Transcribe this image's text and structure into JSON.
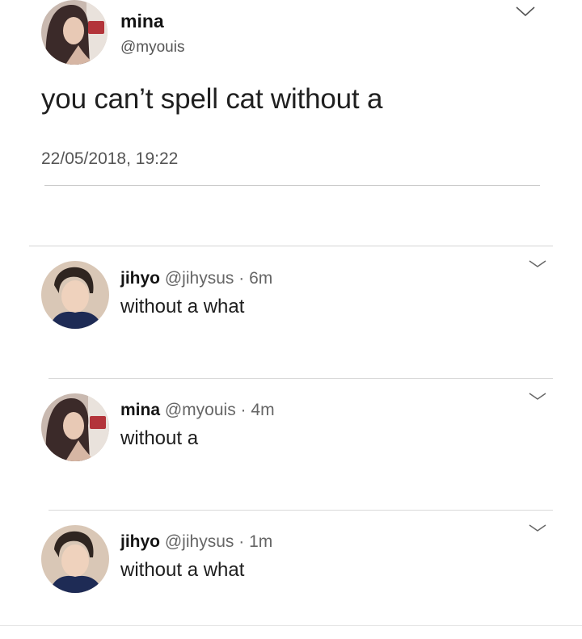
{
  "main_tweet": {
    "name": "mina",
    "handle": "@myouis",
    "text": "you can’t spell cat without a",
    "timestamp": "22/05/2018, 19:22",
    "menu_icon": "chevron-down-icon"
  },
  "replies": [
    {
      "name": "jihyo",
      "handle": "@jihysus",
      "separator": "·",
      "time": "6m",
      "text": "without a what",
      "menu_icon": "chevron-down-icon"
    },
    {
      "name": "mina",
      "handle": "@myouis",
      "separator": "·",
      "time": "4m",
      "text": "without a",
      "menu_icon": "chevron-down-icon"
    },
    {
      "name": "jihyo",
      "handle": "@jihysus",
      "separator": "·",
      "time": "1m",
      "text": "without a what",
      "menu_icon": "chevron-down-icon"
    }
  ],
  "colors": {
    "text": "#1a1a1a",
    "muted": "#666666",
    "divider": "#d9d9d9",
    "background": "#ffffff"
  }
}
